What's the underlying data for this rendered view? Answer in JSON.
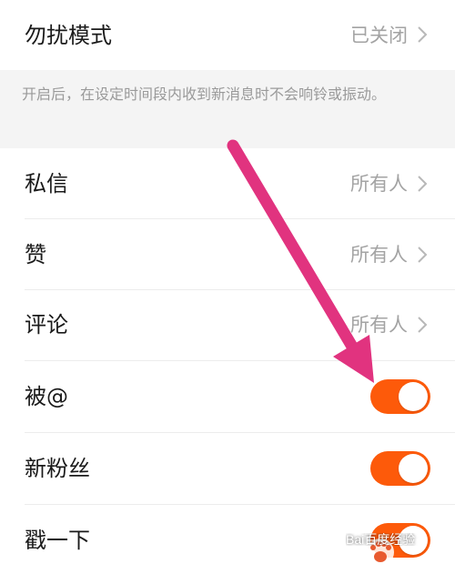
{
  "dnd": {
    "label": "勿扰模式",
    "status": "已关闭"
  },
  "note": "开启后，在设定时间段内收到新消息时不会响铃或振动。",
  "settings": [
    {
      "label": "私信",
      "value": "所有人"
    },
    {
      "label": "赞",
      "value": "所有人"
    },
    {
      "label": "评论",
      "value": "所有人"
    }
  ],
  "toggles": [
    {
      "label": "被@",
      "on": true
    },
    {
      "label": "新粉丝",
      "on": true
    },
    {
      "label": "戳一下",
      "on": true
    }
  ],
  "colors": {
    "accent": "#fd5a0a",
    "arrow": "#e1337f"
  },
  "icons": {
    "chevron": "chevron-right-icon",
    "watermark": "baidu-paw-icon"
  },
  "watermark": "Bai百度经验"
}
